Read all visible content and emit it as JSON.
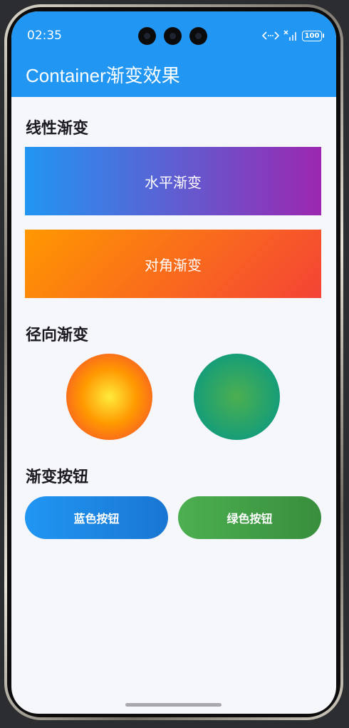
{
  "status_bar": {
    "time": "02:35",
    "battery": "100",
    "network_icons": [
      "code-arrows-icon",
      "no-signal-icon"
    ]
  },
  "app_bar": {
    "title": "Container渐变效果"
  },
  "sections": {
    "linear": {
      "title": "线性渐变",
      "horizontal_label": "水平渐变",
      "diagonal_label": "对角渐变"
    },
    "radial": {
      "title": "径向渐变"
    },
    "buttons": {
      "title": "渐变按钮",
      "blue_label": "蓝色按钮",
      "green_label": "绿色按钮"
    }
  },
  "colors": {
    "app_bar": "#2196f3",
    "horizontal_gradient": [
      "#2196f3",
      "#9c27b0"
    ],
    "diagonal_gradient": [
      "#ff9800",
      "#f44336"
    ],
    "radial_warm": [
      "#ffeb3b",
      "#ff9800",
      "#f44336"
    ],
    "radial_cool": [
      "#4caf50",
      "#009688"
    ],
    "blue_button": [
      "#2196f3",
      "#1976d2"
    ],
    "green_button": [
      "#4caf50",
      "#388e3c"
    ],
    "background": "#f6f7fb"
  }
}
